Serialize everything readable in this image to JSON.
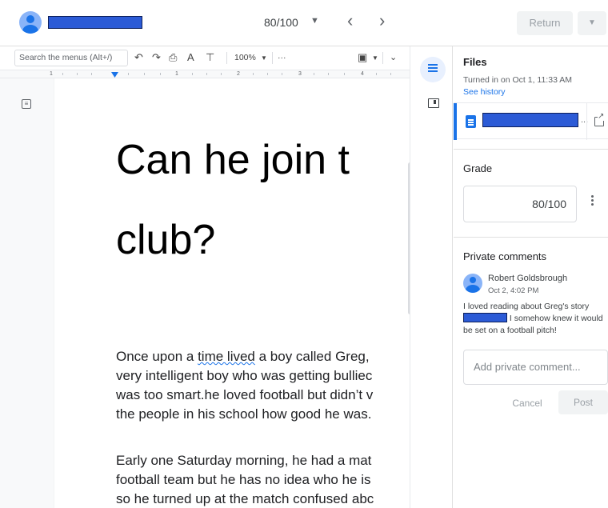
{
  "header": {
    "grade_selector": "80/100",
    "return_label": "Return"
  },
  "doc_toolbar": {
    "search_placeholder": "Search the menus (Alt+/)",
    "zoom": "100%",
    "more": "···",
    "ruler_numbers": [
      "1",
      "1",
      "2",
      "3",
      "4"
    ]
  },
  "document": {
    "title_line1": "Can he join t",
    "title_line2": "club?",
    "para1": [
      {
        "pre": "Once upon a ",
        "spell": "time lived",
        "post": " a boy called Greg,"
      },
      "very intelligent boy who was getting bulliec",
      "was too smart.he loved football but didn’t v",
      "the people in his school how good he was."
    ],
    "para2": [
      "Early one Saturday morning, he had a mat",
      "football team but he has no idea who he is",
      "so he turned up at the match confused abc"
    ]
  },
  "side_panel": {
    "files_title": "Files",
    "turned_in": "Turned in on Oct 1, 11:33 AM",
    "see_history": "See history",
    "file_ellipsis": "...",
    "grade_title": "Grade",
    "grade_value": "80/100",
    "private_comments_title": "Private comments",
    "comment": {
      "author": "Robert Goldsbrough",
      "time": "Oct 2, 4:02 PM",
      "text_before": "I loved reading about Greg's story",
      "text_after": " I somehow knew it would be set on a football pitch!"
    },
    "comment_placeholder": "Add private comment...",
    "cancel_label": "Cancel",
    "post_label": "Post"
  },
  "colors": {
    "accent": "#1a73e8",
    "redaction": "#2c5bd6"
  }
}
